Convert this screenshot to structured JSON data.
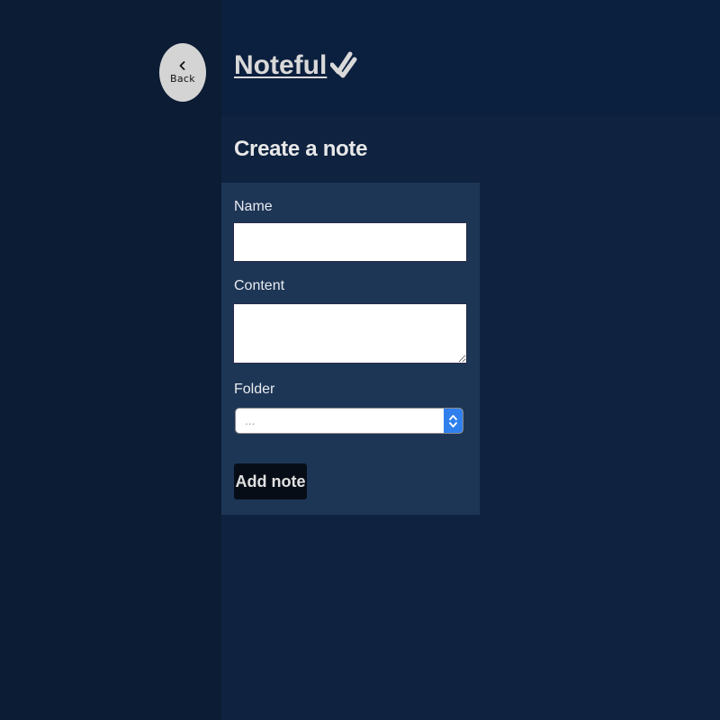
{
  "nav": {
    "back_label": "Back",
    "back_icon": "chevron-left-icon"
  },
  "header": {
    "app_title": "Noteful",
    "title_icon": "double-check-icon"
  },
  "main": {
    "heading": "Create a note"
  },
  "form": {
    "name_label": "Name",
    "name_value": "",
    "content_label": "Content",
    "content_value": "",
    "folder_label": "Folder",
    "folder_selected": "...",
    "submit_label": "Add note"
  },
  "colors": {
    "sidebar_bg": "#0b1c34",
    "header_bg": "#0b1f3e",
    "main_bg": "#0f2340",
    "form_bg": "#1e3656",
    "button_bg": "#060d17",
    "select_accent": "#2f80ed"
  }
}
